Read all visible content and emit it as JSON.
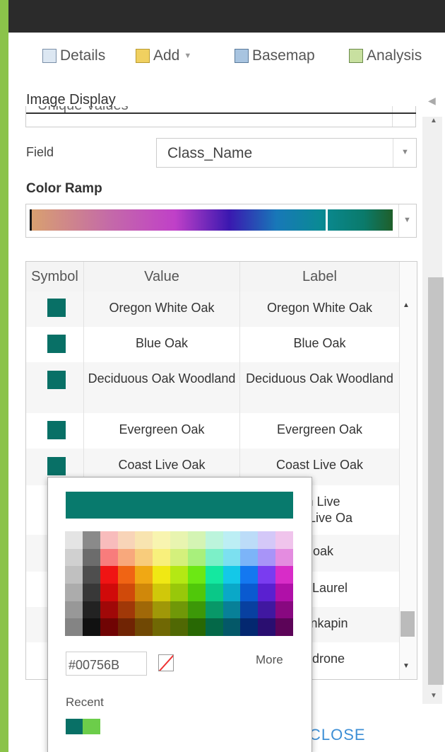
{
  "toolbar": {
    "details": "Details",
    "add": "Add",
    "basemap": "Basemap",
    "analysis": "Analysis"
  },
  "panel": {
    "title": "Image Display",
    "cut_select_text": "Unique Values",
    "field_label": "Field",
    "field_value": "Class_Name",
    "color_ramp_label": "Color Ramp"
  },
  "table": {
    "headers": [
      "Symbol",
      "Value",
      "Label"
    ],
    "rows": [
      {
        "value": "Oregon White Oak",
        "label": "Oregon White Oak"
      },
      {
        "value": "Blue Oak",
        "label": "Blue Oak"
      },
      {
        "value": "Deciduous Oak Woodland",
        "label": "Deciduous Oak Woodland"
      },
      {
        "value": "Evergreen Oak",
        "label": "Evergreen Oak"
      },
      {
        "value": "Coast Live Oak",
        "label": "Coast Live Oak"
      },
      {
        "value": "",
        "label": "on Live\nrior Live Oa"
      },
      {
        "value": "",
        "label": "hoak"
      },
      {
        "value": "",
        "label": "nia Laurel"
      },
      {
        "value": "",
        "label": "Chinkapin"
      },
      {
        "value": "",
        "label": "Madrone"
      }
    ]
  },
  "picker": {
    "hex": "#00756B",
    "more": "More",
    "recent_label": "Recent",
    "preview_color": "#087a6d",
    "recent_colors": [
      "#087066",
      "#6ccd4a"
    ],
    "palette_rows": [
      [
        "#e4e4e4",
        "#8a8a8a",
        "#f8bcbc",
        "#f8d4b8",
        "#f8e4b0",
        "#f8f4b0",
        "#e8f4b0",
        "#d4f4b4",
        "#bcf4dc",
        "#bceef4",
        "#bcdcf8",
        "#d4c8f8",
        "#f0c4ec"
      ],
      [
        "#d0d0d0",
        "#6c6c6c",
        "#f87c7c",
        "#f8a87c",
        "#f8cc7c",
        "#f8f07c",
        "#d4f07c",
        "#a8f07c",
        "#7cf0c8",
        "#7ce0f0",
        "#7cb4f8",
        "#a894f8",
        "#e48ce0"
      ],
      [
        "#c0c0c0",
        "#4e4e4e",
        "#f01414",
        "#f06414",
        "#f0a814",
        "#f0e814",
        "#b4e814",
        "#6ce814",
        "#14e8a0",
        "#14c8e8",
        "#1478f0",
        "#7a3cf0",
        "#d82cc8"
      ],
      [
        "#acacac",
        "#383838",
        "#d00a0a",
        "#d04a0a",
        "#d0880a",
        "#d0c80a",
        "#98c80a",
        "#50c80a",
        "#0ac888",
        "#0aa8c8",
        "#0a5ad0",
        "#5a20d0",
        "#b010a8"
      ],
      [
        "#989898",
        "#222222",
        "#a00808",
        "#a03808",
        "#a06808",
        "#a09808",
        "#709808",
        "#3c9808",
        "#089868",
        "#088098",
        "#0840a0",
        "#4018a0",
        "#880880"
      ],
      [
        "#848484",
        "#111111",
        "#700404",
        "#702404",
        "#704804",
        "#706804",
        "#506804",
        "#286804",
        "#046848",
        "#045868",
        "#042870",
        "#2a0e70",
        "#5c0458"
      ]
    ]
  },
  "footer": {
    "close": "CLOSE"
  }
}
